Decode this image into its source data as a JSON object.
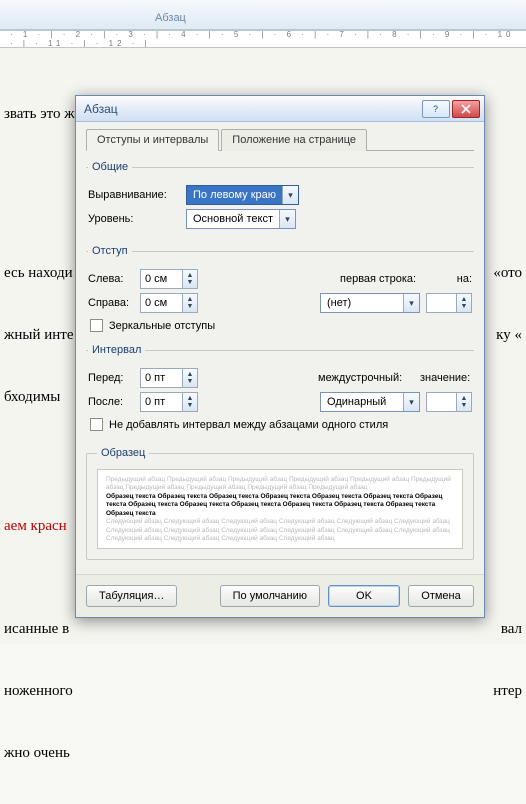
{
  "ribbon": {
    "group_label": "Абзац"
  },
  "ruler": "· 1 · | · 2 · | · 3 · | · 4 · | · 5 · | · 6 · | · 7 · | · 8 · | · 9 · | · 10 · | · 11 · | · 12 · | ",
  "doc": {
    "line1": "звать это же меню можно нажав на вкладку абзац в верхней панели р",
    "line2a": "есь находи",
    "line2b": "«ото",
    "line3a": "жный инте",
    "line3b": "ку «",
    "line4": "бходимы",
    "line5": "аем красн",
    "line6a": "исанные в",
    "line6b": "вал",
    "line7a": "ноженного",
    "line7b": "нтер",
    "line8": "жно очень"
  },
  "dialog": {
    "title": "Абзац",
    "tabs": {
      "indent": "Отступы и интервалы",
      "position": "Положение на странице"
    },
    "general": {
      "legend": "Общие",
      "alignment_label": "Выравнивание:",
      "alignment_value": "По левому краю",
      "level_label": "Уровень:",
      "level_value": "Основной текст"
    },
    "indent": {
      "legend": "Отступ",
      "left_label": "Слева:",
      "left_value": "0 см",
      "right_label": "Справа:",
      "right_value": "0 см",
      "first_line_label": "первая строка:",
      "first_line_value": "(нет)",
      "by_label": "на:",
      "mirror_label": "Зеркальные отступы"
    },
    "spacing": {
      "legend": "Интервал",
      "before_label": "Перед:",
      "before_value": "0 пт",
      "after_label": "После:",
      "after_value": "0 пт",
      "line_spacing_label": "междустрочный:",
      "line_spacing_value": "Одинарный",
      "at_label": "значение:",
      "nosame_label": "Не добавлять интервал между абзацами одного стиля"
    },
    "preview": {
      "legend": "Образец",
      "gray1": "Предыдущий абзац Предыдущий абзац Предыдущий абзац Предыдущий абзац Предыдущий абзац Предыдущий абзац Предыдущий абзац Предыдущий абзац Предыдущий абзац Предыдущий абзац",
      "bold": "Образец текста Образец текста Образец текста Образец текста Образец текста Образец текста Образец текста Образец текста Образец текста Образец текста Образец текста Образец текста Образец текста Образец текста",
      "gray2": "Следующий абзац Следующий абзац Следующий абзац Следующий абзац Следующий абзац Следующий абзац Следующий абзац Следующий абзац Следующий абзац Следующий абзац Следующий абзац Следующий абзац Следующий абзац Следующий абзац Следующий абзац Следующий абзац"
    },
    "footer": {
      "tabs": "Табуляция…",
      "default": "По умолчанию",
      "ok": "OK",
      "cancel": "Отмена"
    }
  }
}
